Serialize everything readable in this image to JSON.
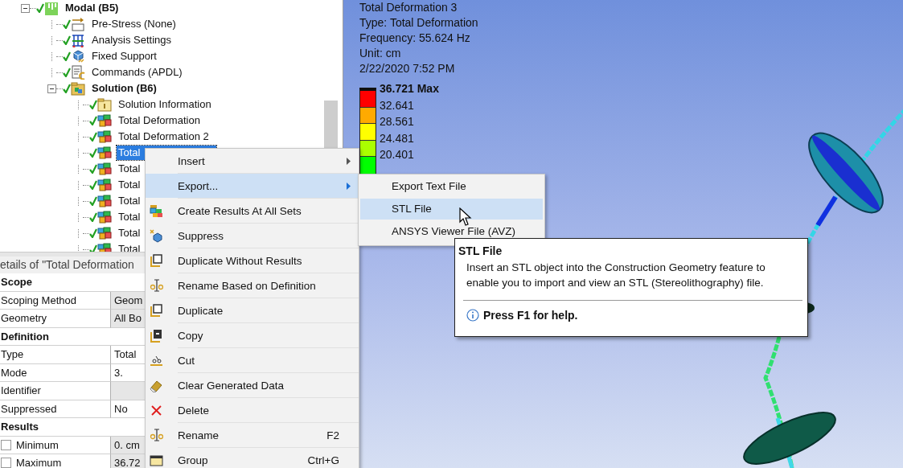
{
  "tree": [
    {
      "label": "Modal (B5)",
      "kind": "modal",
      "bold": true,
      "expanded": true,
      "solved": true,
      "selected": false,
      "children": [
        {
          "label": "Pre-Stress (None)",
          "kind": "prestress",
          "bold": false,
          "solved": true,
          "selected": false
        },
        {
          "label": "Analysis Settings",
          "kind": "settings",
          "bold": false,
          "solved": true,
          "selected": false
        },
        {
          "label": "Fixed Support",
          "kind": "support",
          "bold": false,
          "solved": true,
          "selected": false
        },
        {
          "label": "Commands (APDL)",
          "kind": "commands",
          "bold": false,
          "solved": true,
          "selected": false
        },
        {
          "label": "Solution (B6)",
          "kind": "solution",
          "bold": true,
          "expanded": true,
          "solved": true,
          "selected": false,
          "children": [
            {
              "label": "Solution Information",
              "kind": "info",
              "bold": false,
              "solved": true,
              "selected": false
            },
            {
              "label": "Total Deformation",
              "kind": "result",
              "bold": false,
              "solved": true,
              "selected": false
            },
            {
              "label": "Total Deformation 2",
              "kind": "result",
              "bold": false,
              "solved": true,
              "selected": false
            },
            {
              "label": "Total",
              "kind": "result",
              "bold": false,
              "solved": true,
              "selected": true
            },
            {
              "label": "Total",
              "kind": "result",
              "bold": false,
              "solved": true,
              "selected": false
            },
            {
              "label": "Total",
              "kind": "result",
              "bold": false,
              "solved": true,
              "selected": false
            },
            {
              "label": "Total",
              "kind": "result",
              "bold": false,
              "solved": true,
              "selected": false
            },
            {
              "label": "Total",
              "kind": "result",
              "bold": false,
              "solved": true,
              "selected": false
            },
            {
              "label": "Total",
              "kind": "result",
              "bold": false,
              "solved": true,
              "selected": false
            },
            {
              "label": "Total",
              "kind": "result",
              "bold": false,
              "solved": true,
              "selected": false
            }
          ]
        }
      ]
    }
  ],
  "details": {
    "title": "etails of \"Total Deformation",
    "rows": [
      {
        "kind": "section",
        "label": "Scope"
      },
      {
        "kind": "property",
        "label": "Scoping Method",
        "value": "Geom",
        "readonly": true
      },
      {
        "kind": "property",
        "label": "Geometry",
        "value": "All Bo",
        "readonly": true
      },
      {
        "kind": "section",
        "label": "Definition"
      },
      {
        "kind": "property",
        "label": "Type",
        "value": "Total",
        "readonly": false
      },
      {
        "kind": "property",
        "label": "Mode",
        "value": "3.",
        "readonly": false
      },
      {
        "kind": "property",
        "label": "Identifier",
        "readonly": true
      },
      {
        "kind": "property",
        "label": "Suppressed",
        "value": "No",
        "readonly": false
      },
      {
        "kind": "section",
        "label": "Results"
      },
      {
        "kind": "check",
        "label": "Minimum",
        "checked": false,
        "value": "0. cm",
        "readonly": true
      },
      {
        "kind": "check",
        "label": "Maximum",
        "checked": false,
        "value": "36.72",
        "readonly": true
      }
    ]
  },
  "viewport": {
    "info": [
      "Total Deformation 3",
      "Type: Total Deformation",
      "Frequency: 55.624 Hz",
      "Unit: cm",
      "2/22/2020 7:52 PM"
    ],
    "legend": [
      {
        "label": "36.721 Max",
        "kind": "max",
        "color": "#ff0000"
      },
      {
        "label": "32.641",
        "kind": "value",
        "color": "#ffaa00"
      },
      {
        "label": "28.561",
        "kind": "value",
        "color": "#ffff00"
      },
      {
        "label": "24.481",
        "kind": "value",
        "color": "#aaff00"
      },
      {
        "label": "20.401",
        "kind": "value",
        "color": "#00ff00"
      }
    ]
  },
  "context_menu": [
    {
      "label": "Insert",
      "submenu": true,
      "selected": false
    },
    {
      "label": "Export...",
      "submenu": true,
      "selected": true
    },
    {
      "label": "Create Results At All Sets",
      "kind": "results",
      "selected": false
    },
    {
      "label": "Suppress",
      "kind": "suppress",
      "selected": false
    },
    {
      "label": "Duplicate Without Results",
      "kind": "duplicate",
      "selected": false
    },
    {
      "label": "Rename Based on Definition",
      "kind": "rename",
      "selected": false
    },
    {
      "label": "Duplicate",
      "kind": "duplicate",
      "selected": false
    },
    {
      "label": "Copy",
      "kind": "copy",
      "selected": false
    },
    {
      "label": "Cut",
      "kind": "cut",
      "selected": false
    },
    {
      "label": "Clear Generated Data",
      "kind": "clear",
      "selected": false
    },
    {
      "label": "Delete",
      "kind": "delete",
      "selected": false
    },
    {
      "label": "Rename",
      "kind": "rename",
      "shortcut": "F2",
      "selected": false
    },
    {
      "label": "Group",
      "kind": "group",
      "shortcut": "Ctrl+G",
      "selected": false
    }
  ],
  "submenu": [
    {
      "label": "Export Text File",
      "selected": false
    },
    {
      "label": "STL File",
      "selected": true
    },
    {
      "label": "ANSYS Viewer File (AVZ)",
      "selected": false
    }
  ],
  "tooltip": {
    "title": "STL File",
    "body": "Insert an STL object into the Construction Geometry feature to enable you to import and view an STL (Stereolithography) file.",
    "help": "Press F1 for help."
  }
}
